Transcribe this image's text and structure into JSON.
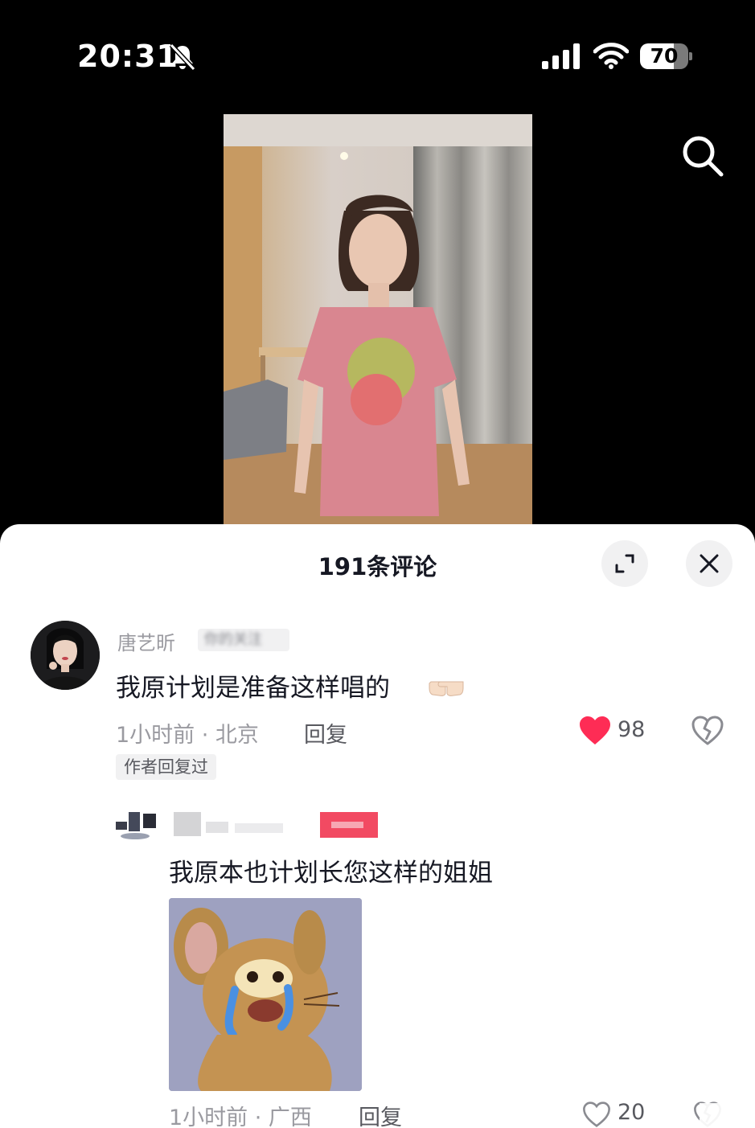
{
  "status_bar": {
    "time": "20:31",
    "battery_level": 70,
    "battery_label": "70"
  },
  "comments_panel": {
    "title": "191条评论",
    "comment": {
      "username": "唐艺昕",
      "follow_tag": "你的关注",
      "text": "我原计划是准备这样唱的",
      "time_location": "1小时前 · 北京",
      "reply_label": "回复",
      "like_count": "98",
      "author_badge": "作者回复过"
    },
    "reply": {
      "text": "我原本也计划长您这样的姐姐",
      "time_location": "1小时前 · 广西",
      "reply_label": "回复",
      "like_count": "20"
    }
  },
  "colors": {
    "like_red": "#fe2c55",
    "sheet_bg": "#ffffff",
    "muted_text": "#9a9aa0"
  }
}
